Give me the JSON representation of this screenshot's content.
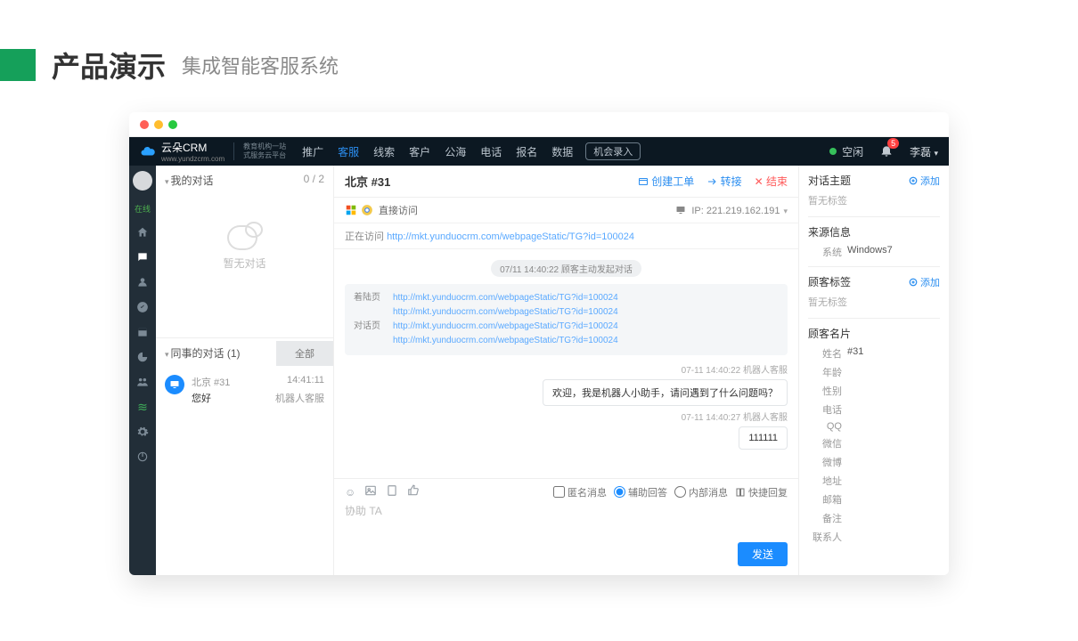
{
  "header": {
    "title": "产品演示",
    "subtitle": "集成智能客服系统"
  },
  "brand": {
    "name": "云朵CRM",
    "url": "www.yundzcrm.com",
    "tag1": "教育机构一站",
    "tag2": "式服务云平台"
  },
  "nav": {
    "items": [
      "推广",
      "客服",
      "线索",
      "客户",
      "公海",
      "电话",
      "报名",
      "数据"
    ],
    "active": 1,
    "record_btn": "机会录入",
    "idle": "空闲",
    "user": "李磊",
    "badge": "5"
  },
  "rail": {
    "status": "在线"
  },
  "conv": {
    "my_label": "我的对话",
    "my_count": "0 / 2",
    "empty": "暂无对话",
    "peer_label": "同事的对话  (1)",
    "all_label": "全部",
    "item": {
      "loc": "北京  #31",
      "time": "14:41:11",
      "msg": "您好",
      "agent": "机器人客服"
    }
  },
  "chat": {
    "title": "北京 #31",
    "actions": {
      "ticket": "创建工单",
      "transfer": "转接",
      "end": "结束"
    },
    "direct": "直接访问",
    "direct_ip_label": "IP:",
    "direct_ip": "221.219.162.191",
    "visiting_label": "正在访问",
    "visiting_url": "http://mkt.yunduocrm.com/webpageStatic/TG?id=100024",
    "sys_chip": "07/11 14:40:22  顾客主动发起对话",
    "links": {
      "landing_label": "着陆页",
      "landing": [
        "http://mkt.yunduocrm.com/webpageStatic/TG?id=100024",
        "http://mkt.yunduocrm.com/webpageStatic/TG?id=100024"
      ],
      "dialog_label": "对话页",
      "dialog": [
        "http://mkt.yunduocrm.com/webpageStatic/TG?id=100024",
        "http://mkt.yunduocrm.com/webpageStatic/TG?id=100024"
      ]
    },
    "msgs": [
      {
        "meta": "07-11 14:40:22  机器人客服",
        "text": "欢迎，我是机器人小助手，请问遇到了什么问题吗？"
      },
      {
        "meta": "07-11 14:40:27  机器人客服",
        "text": "111111"
      }
    ],
    "composer": {
      "placeholder": "协助 TA",
      "anon": "匿名消息",
      "assist": "辅助回答",
      "internal": "内部消息",
      "quick": "快捷回复",
      "send": "发送"
    }
  },
  "side": {
    "topic_label": "对话主题",
    "add": "添加",
    "no_tag": "暂无标签",
    "source_label": "来源信息",
    "source_sys_k": "系统",
    "source_sys_v": "Windows7",
    "tags_label": "顾客标签",
    "card_label": "顾客名片",
    "card": [
      {
        "k": "姓名",
        "v": "#31"
      },
      {
        "k": "年龄",
        "v": ""
      },
      {
        "k": "性别",
        "v": ""
      },
      {
        "k": "电话",
        "v": ""
      },
      {
        "k": "QQ",
        "v": ""
      },
      {
        "k": "微信",
        "v": ""
      },
      {
        "k": "微博",
        "v": ""
      },
      {
        "k": "地址",
        "v": ""
      },
      {
        "k": "邮箱",
        "v": ""
      },
      {
        "k": "备注",
        "v": ""
      },
      {
        "k": "联系人",
        "v": ""
      }
    ]
  }
}
